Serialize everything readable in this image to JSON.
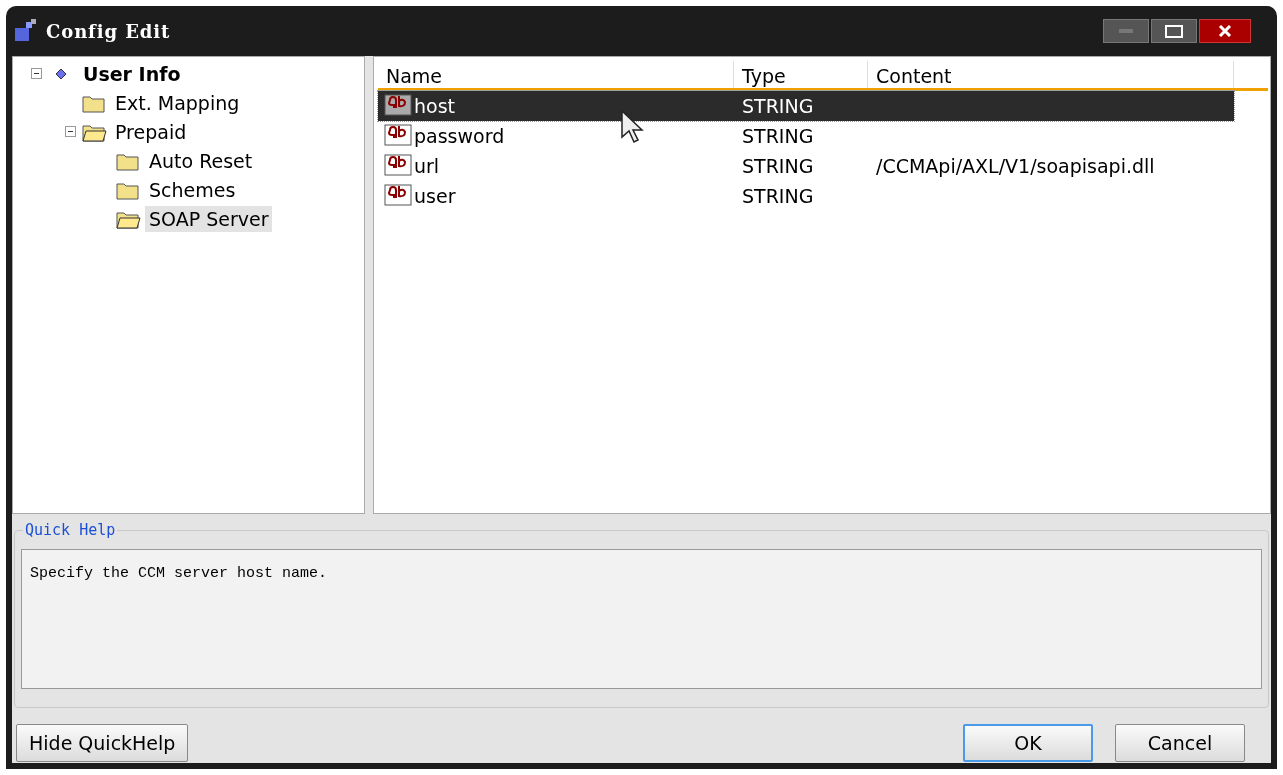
{
  "window": {
    "title": "Config Edit"
  },
  "tree": [
    {
      "label": "User Info",
      "expanded": true,
      "selected": false,
      "kind": "root",
      "children": [
        {
          "label": "Ext. Mapping",
          "selected": false,
          "kind": "folder",
          "expanded": false
        },
        {
          "label": "Prepaid",
          "selected": false,
          "kind": "folder",
          "expanded": true,
          "children": [
            {
              "label": "Auto Reset",
              "selected": false,
              "kind": "folder",
              "expanded": false
            },
            {
              "label": "Schemes",
              "selected": false,
              "kind": "folder",
              "expanded": false
            },
            {
              "label": "SOAP Server",
              "selected": true,
              "kind": "folder",
              "expanded": false
            }
          ]
        }
      ]
    }
  ],
  "table": {
    "columns": [
      "Name",
      "Type",
      "Content"
    ],
    "rows": [
      {
        "name": "host",
        "type": "STRING",
        "content": "",
        "selected": true
      },
      {
        "name": "password",
        "type": "STRING",
        "content": "",
        "selected": false
      },
      {
        "name": "url",
        "type": "STRING",
        "content": "/CCMApi/AXL/V1/soapisapi.dll",
        "selected": false
      },
      {
        "name": "user",
        "type": "STRING",
        "content": "",
        "selected": false
      }
    ]
  },
  "quick_help": {
    "title": "Quick Help",
    "text": "Specify the CCM server host name."
  },
  "buttons": {
    "toggle": "Hide QuickHelp",
    "ok": "OK",
    "cancel": "Cancel"
  }
}
